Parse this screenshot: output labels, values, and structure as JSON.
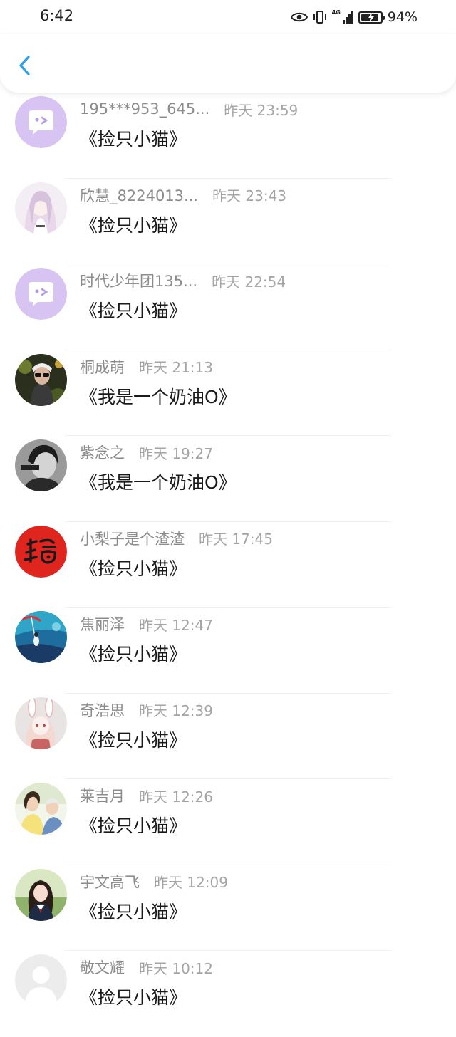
{
  "status_bar": {
    "time": "6:42",
    "network": "4G",
    "battery_percent": "94%",
    "battery_level": 0.94
  },
  "nav": {
    "back_icon": "chevron-left-icon",
    "accent": "#2aa0ea"
  },
  "items": [
    {
      "name": "195***953_645...",
      "time": "昨天 23:59",
      "title": "《捡只小猫》",
      "avatar": "default-chat-avatar"
    },
    {
      "name": "欣慧_8224013...",
      "time": "昨天 23:43",
      "title": "《捡只小猫》",
      "avatar": "anime-girl-avatar"
    },
    {
      "name": "时代少年团135...",
      "time": "昨天 22:54",
      "title": "《捡只小猫》",
      "avatar": "default-chat-avatar"
    },
    {
      "name": "桐成萌",
      "time": "昨天 21:13",
      "title": "《我是一个奶油O》",
      "avatar": "sunglasses-avatar"
    },
    {
      "name": "紫念之",
      "time": "昨天 19:27",
      "title": "《我是一个奶油O》",
      "avatar": "portrait-avatar"
    },
    {
      "name": "小梨子是个渣渣",
      "time": "昨天 17:45",
      "title": "《捡只小猫》",
      "avatar": "red-calligraphy-avatar"
    },
    {
      "name": "焦丽泽",
      "time": "昨天 12:47",
      "title": "《捡只小猫》",
      "avatar": "blue-scene-avatar"
    },
    {
      "name": "奇浩思",
      "time": "昨天 12:39",
      "title": "《捡只小猫》",
      "avatar": "bunny-girl-avatar"
    },
    {
      "name": "莱吉月",
      "time": "昨天 12:26",
      "title": "《捡只小猫》",
      "avatar": "couple-photo-avatar"
    },
    {
      "name": "宇文高飞",
      "time": "昨天 12:09",
      "title": "《捡只小猫》",
      "avatar": "girl-photo-avatar"
    },
    {
      "name": "敬文耀",
      "time": "昨天 10:12",
      "title": "《捡只小猫》",
      "avatar": "default-person-avatar"
    }
  ]
}
